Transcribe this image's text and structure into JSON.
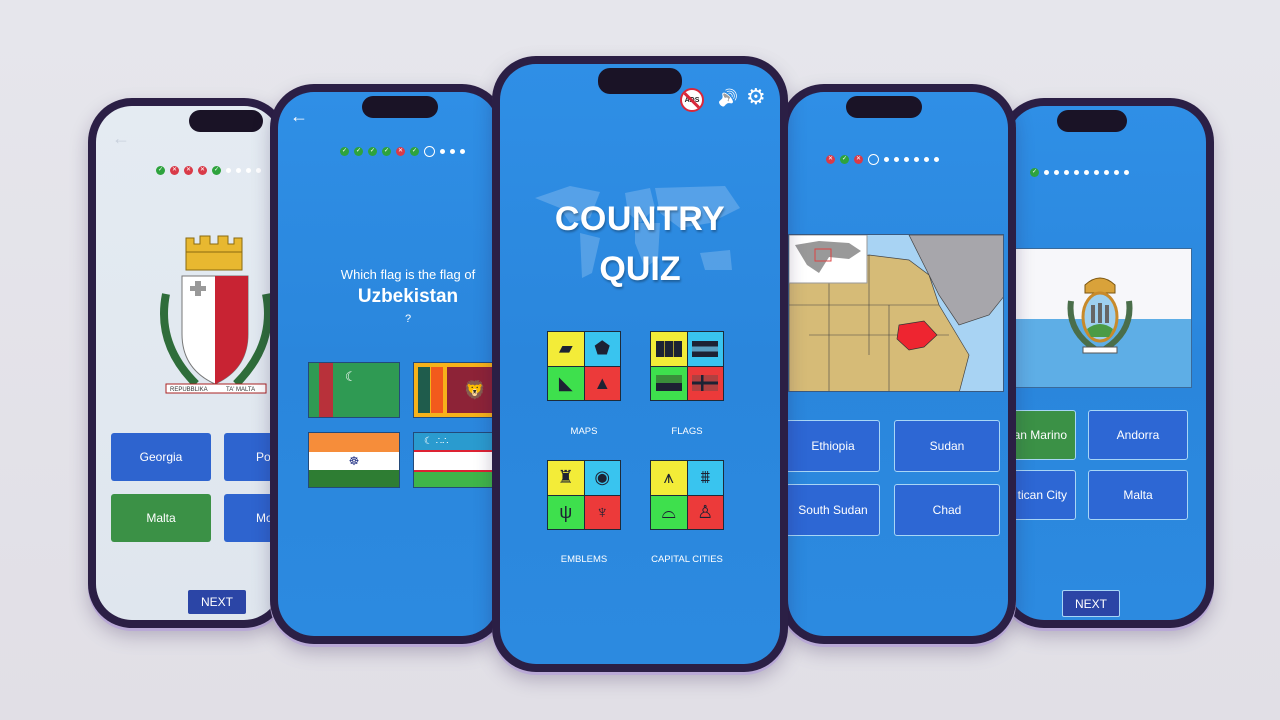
{
  "colors": {
    "screen_blue": "#2c8ae0",
    "answer_blue": "#2e64cf",
    "correct_green": "#3b9146",
    "wrong_red": "#d93a48",
    "next_blue": "#2b45a6",
    "phone_frame": "#2b1f45"
  },
  "phone1": {
    "screen": "emblem-quiz",
    "back_icon": "←",
    "progress": [
      "ok",
      "bad",
      "bad",
      "bad",
      "ok",
      "pending",
      "pending",
      "pending",
      "pending"
    ],
    "emblem": "Coat of arms of Malta",
    "emblem_motto_left": "REPUBBLIKA",
    "emblem_motto_right": "TA' MALTA",
    "answers": [
      {
        "label": "Georgia",
        "state": "normal"
      },
      {
        "label": "Po",
        "state": "normal"
      },
      {
        "label": "Malta",
        "state": "correct"
      },
      {
        "label": "Mo",
        "state": "normal"
      }
    ],
    "next_label": "NEXT"
  },
  "phone2": {
    "screen": "flag-quiz",
    "back_icon": "←",
    "progress": [
      "ok",
      "ok",
      "ok",
      "ok",
      "bad",
      "ok",
      "current",
      "pending",
      "pending",
      "pending"
    ],
    "question_prefix": "Which flag is the flag of",
    "question_country": "Uzbekistan",
    "question_suffix": "?",
    "flags": [
      "Turkmenistan",
      "Sri Lanka",
      "India",
      "Uzbekistan"
    ]
  },
  "phone3": {
    "screen": "home",
    "no_ads_icon": "ADS",
    "sound_icon": "🔊",
    "settings_icon": "⚙",
    "title_line1": "COUNTRY",
    "title_line2": "QUIZ",
    "categories": [
      {
        "label": "MAPS",
        "icons": [
          "Europe",
          "Africa",
          "South America",
          "Asia"
        ]
      },
      {
        "label": "FLAGS",
        "icons": [
          "flag",
          "flag",
          "flag",
          "flag"
        ]
      },
      {
        "label": "EMBLEMS",
        "icons": [
          "emblem",
          "emblem",
          "emblem",
          "emblem"
        ]
      },
      {
        "label": "CAPITAL CITIES",
        "icons": [
          "Eiffel Tower",
          "Brandenburg Gate",
          "Colosseum",
          "Big Ben"
        ]
      }
    ]
  },
  "phone4": {
    "screen": "map-quiz",
    "progress": [
      "bad",
      "ok",
      "bad",
      "current",
      "pending",
      "pending",
      "pending",
      "pending",
      "pending",
      "pending"
    ],
    "map_region": "Africa with South Sudan highlighted",
    "answers": [
      {
        "label": "Ethiopia",
        "state": "normal"
      },
      {
        "label": "Sudan",
        "state": "normal"
      },
      {
        "label": "South Sudan",
        "state": "normal"
      },
      {
        "label": "Chad",
        "state": "normal"
      }
    ]
  },
  "phone5": {
    "screen": "flag-answer-quiz",
    "progress": [
      "ok",
      "pending",
      "pending",
      "pending",
      "pending",
      "pending",
      "pending",
      "pending",
      "pending",
      "pending"
    ],
    "flag": "San Marino",
    "answers": [
      {
        "label": "an Marino",
        "state": "correct"
      },
      {
        "label": "Andorra",
        "state": "normal"
      },
      {
        "label": "tican City",
        "state": "normal"
      },
      {
        "label": "Malta",
        "state": "normal"
      }
    ],
    "next_label": "NEXT"
  }
}
